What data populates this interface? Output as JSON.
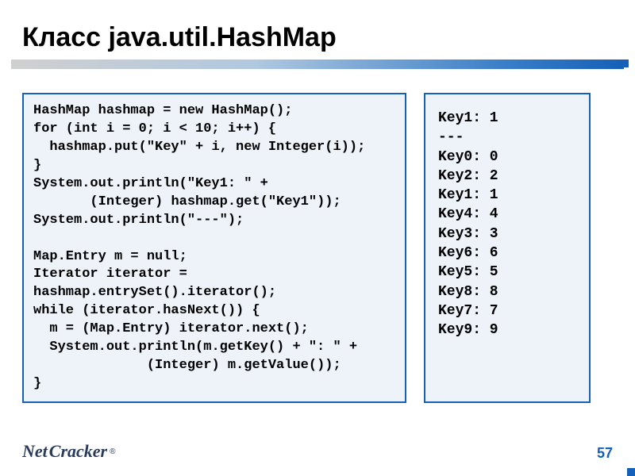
{
  "title": "Класс java.util.HashMap",
  "code_left": "HashMap hashmap = new HashMap();\nfor (int i = 0; i < 10; i++) {\n  hashmap.put(\"Key\" + i, new Integer(i));\n}\nSystem.out.println(\"Key1: \" +\n       (Integer) hashmap.get(\"Key1\"));\nSystem.out.println(\"---\");\n\nMap.Entry m = null;\nIterator iterator =\nhashmap.entrySet().iterator();\nwhile (iterator.hasNext()) {\n  m = (Map.Entry) iterator.next();\n  System.out.println(m.getKey() + \": \" +\n              (Integer) m.getValue());\n}",
  "output_right": "Key1: 1\n---\nKey0: 0\nKey2: 2\nKey1: 1\nKey4: 4\nKey3: 3\nKey6: 6\nKey5: 5\nKey8: 8\nKey7: 7\nKey9: 9",
  "logo_net": "Net",
  "logo_cracker": "Cracker",
  "logo_reg": "®",
  "page_number": "57"
}
